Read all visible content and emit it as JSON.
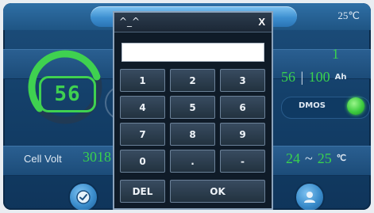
{
  "status": {
    "temperature": "25℃"
  },
  "soc": {
    "value": "56",
    "percent": 56
  },
  "summary": {
    "count": "1",
    "remaining_capacity": "56",
    "full_capacity": "100",
    "capacity_unit": "Ah"
  },
  "dmos": {
    "label": "DMOS",
    "led_color": "#3dcc3f"
  },
  "cell_volt": {
    "label": "Cell Volt",
    "value": "3018"
  },
  "temp_range": {
    "min": "24",
    "separator": "~",
    "max": "25",
    "unit": "℃"
  },
  "keypad": {
    "title": "^_^",
    "close_label": "X",
    "display_value": "",
    "keys": [
      [
        "1",
        "2",
        "3"
      ],
      [
        "4",
        "5",
        "6"
      ],
      [
        "7",
        "8",
        "9"
      ],
      [
        "0",
        ".",
        "-"
      ]
    ],
    "del_label": "DEL",
    "ok_label": "OK"
  },
  "colors": {
    "accent_green": "#39d14e",
    "panel_blue": "#1d4f7d",
    "keypad_bg": "#0f1b28"
  },
  "icons": {
    "left_button": "check-shield-icon",
    "right_button": "user-icon"
  }
}
